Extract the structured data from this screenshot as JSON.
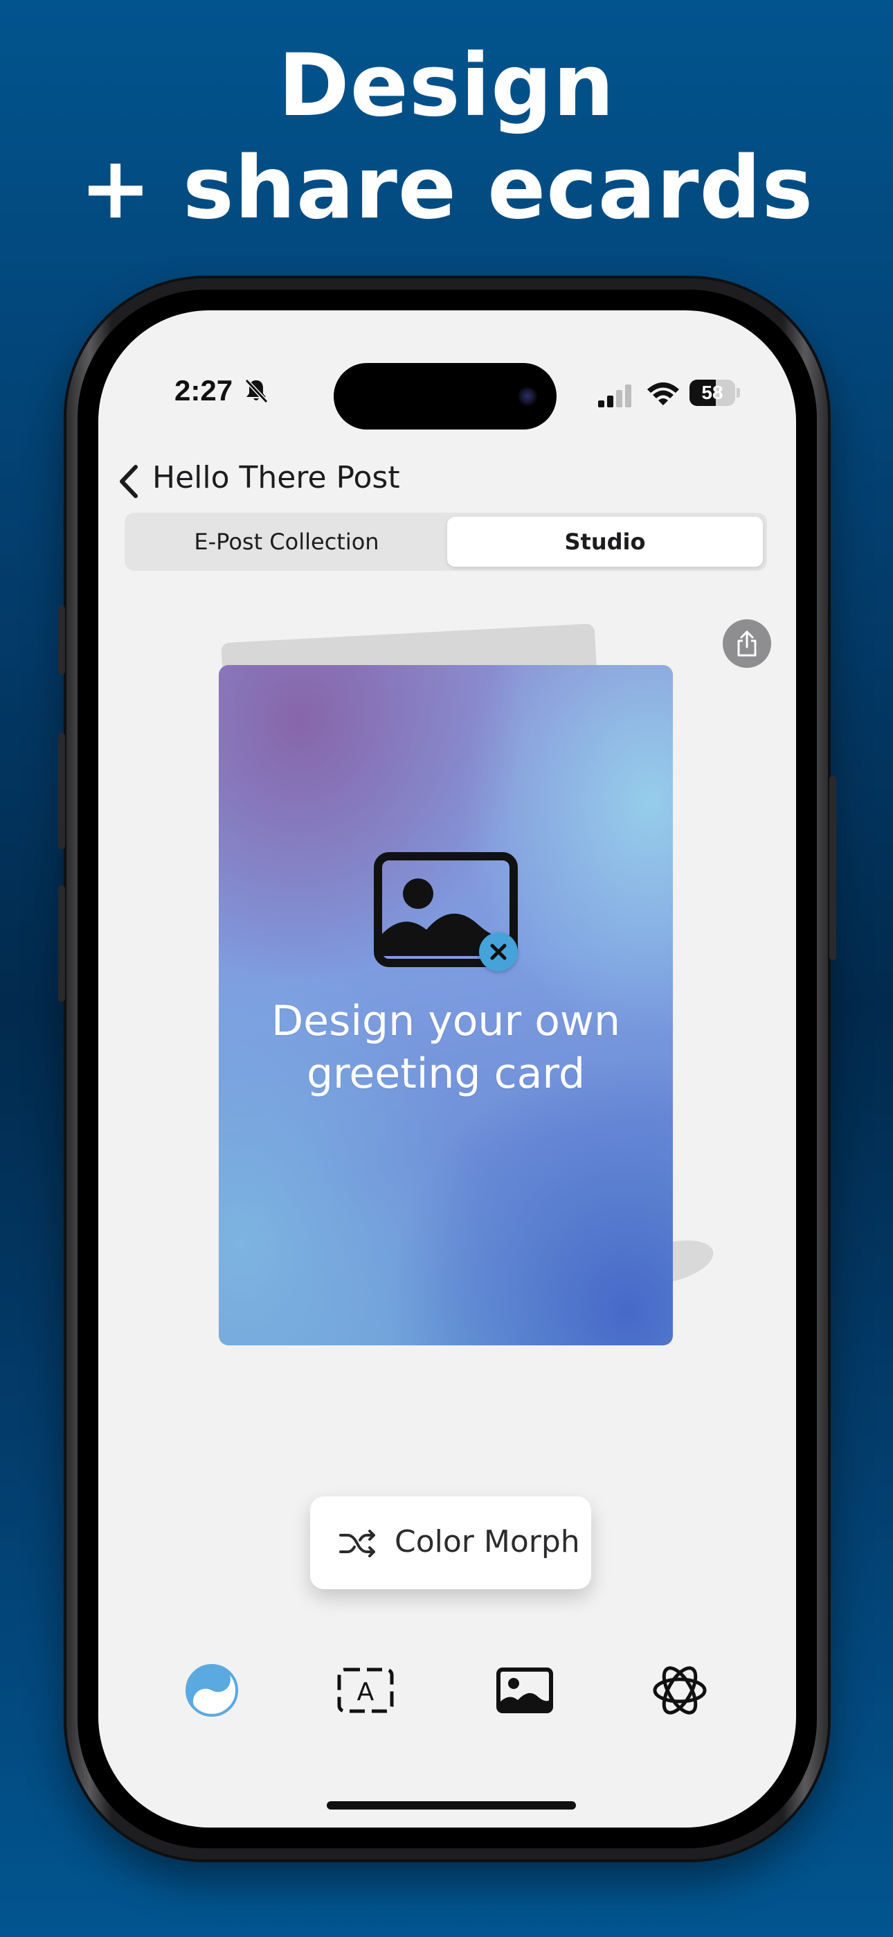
{
  "headline": {
    "line1": "Design",
    "line2": "+ share ecards"
  },
  "status_bar": {
    "time": "2:27",
    "battery_percent": "58",
    "battery_level": 0.58,
    "silent_icon": "bell-slash-icon",
    "signal_icon": "cellular-signal-icon",
    "wifi_icon": "wifi-icon"
  },
  "nav": {
    "back_icon": "chevron-left-icon",
    "title": "Hello There Post"
  },
  "segmented_control": {
    "options": [
      "E-Post Collection",
      "Studio"
    ],
    "selected": "Studio"
  },
  "card": {
    "share_icon": "share-icon",
    "placeholder_icon": "photo-icon",
    "remove_icon": "xmark-circle-icon",
    "text_line1": "Design your own",
    "text_line2": "greeting card"
  },
  "color_morph": {
    "icon": "shuffle-icon",
    "label": "Color Morph"
  },
  "toolbar": {
    "items": [
      {
        "icon": "color-swirl-icon",
        "color": "#5aa9e0"
      },
      {
        "icon": "text-frame-icon",
        "color": "#111111"
      },
      {
        "icon": "photo-icon",
        "color": "#111111"
      },
      {
        "icon": "atom-effects-icon",
        "color": "#111111"
      }
    ]
  },
  "colors": {
    "background_top": "#02548e",
    "background_mid": "#022a4d",
    "screen_bg": "#f2f2f2",
    "accent": "#45a3d9"
  }
}
